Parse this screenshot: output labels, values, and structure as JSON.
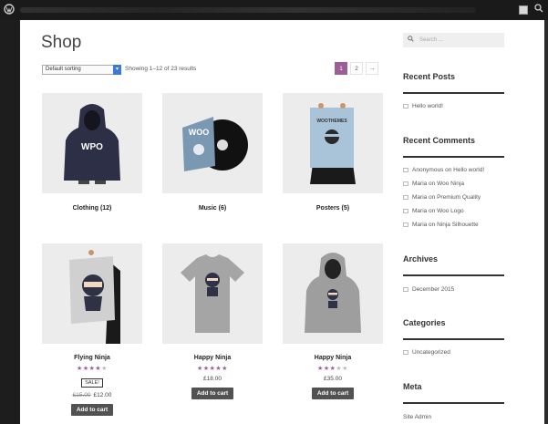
{
  "page": {
    "title": "Shop",
    "sorting_value": "Default sorting",
    "result_count": "Showing 1–12 of 23 results",
    "pagination": [
      "1",
      "2",
      "→"
    ]
  },
  "categories": [
    {
      "name": "Clothing",
      "count": "(12)"
    },
    {
      "name": "Music",
      "count": "(6)"
    },
    {
      "name": "Posters",
      "count": "(5)"
    }
  ],
  "products": [
    {
      "name": "Flying Ninja",
      "rating": 4,
      "sale": "SALE!",
      "old_price": "£15.00",
      "price": "£12.00",
      "button": "Add to cart"
    },
    {
      "name": "Happy Ninja",
      "rating": 5,
      "price": "£18.00",
      "button": "Add to cart"
    },
    {
      "name": "Happy Ninja",
      "rating": 3,
      "price": "£35.00",
      "button": "Add to cart"
    }
  ],
  "product_art": {
    "hoodie_text": "WPO",
    "album_text": "WOO",
    "poster_text": "WOOTHEMES"
  },
  "sidebar": {
    "search_placeholder": "Search ...",
    "recent_posts_title": "Recent Posts",
    "recent_posts": [
      "Hello world!"
    ],
    "recent_comments_title": "Recent Comments",
    "recent_comments": [
      "Anonymous on Hello world!",
      "Maria on Woo Ninja",
      "Maria on Premium Quality",
      "Maria on Woo Logo",
      "Maria on Ninja Silhouette"
    ],
    "archives_title": "Archives",
    "archives": [
      "December 2015"
    ],
    "categories_title": "Categories",
    "categories": [
      "Uncategorized"
    ],
    "meta_title": "Meta",
    "meta": [
      "Site Admin"
    ]
  },
  "colors": {
    "accent": "#9b5e97",
    "button": "#525252",
    "adminbar": "#1a1a1a",
    "select_caret": "#3b7bd4"
  },
  "icons": [
    "wordpress-icon",
    "search-icon",
    "comment-icon",
    "folder-icon",
    "document-icon"
  ]
}
